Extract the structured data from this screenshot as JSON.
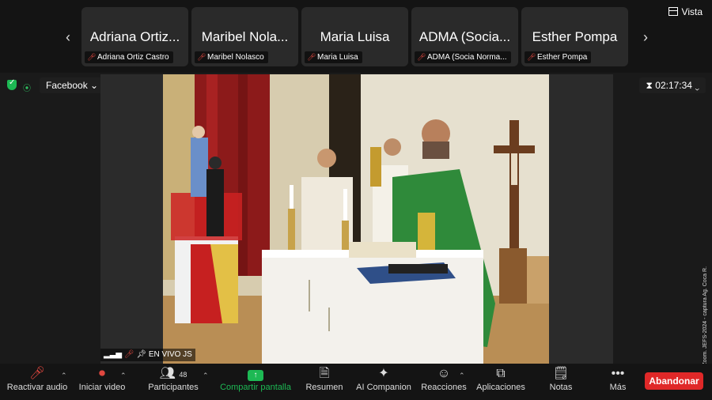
{
  "participants_strip": {
    "tiles": [
      {
        "display": "Adriana Ortiz...",
        "name": "Adriana Ortiz Castro"
      },
      {
        "display": "Maribel Nola...",
        "name": "Maribel Nolasco"
      },
      {
        "display": "Maria Luisa",
        "name": "Maria Luisa"
      },
      {
        "display": "ADMA (Socia...",
        "name": "ADMA (Socia Norma..."
      },
      {
        "display": "Esther Pompa",
        "name": "Esther Pompa"
      }
    ],
    "view_label": "Vista"
  },
  "status": {
    "stream_label": "Facebook",
    "timer": "02:17:34"
  },
  "video": {
    "live_label": "EN VIVO JS",
    "credit": "Cortesía © Zoom. JEFS-2024 - captura Ag. Coca R."
  },
  "toolbar": {
    "audio": "Reactivar audio",
    "video": "Iniciar video",
    "participants": "Participantes",
    "participants_count": "48",
    "share": "Compartir pantalla",
    "summary": "Resumen",
    "companion": "AI Companion",
    "reactions": "Reacciones",
    "apps": "Aplicaciones",
    "notes": "Notas",
    "more": "Más",
    "leave": "Abandonar"
  },
  "colors": {
    "share_green": "#1db954",
    "leave_red": "#e02828",
    "muted_red": "#e0473f"
  }
}
